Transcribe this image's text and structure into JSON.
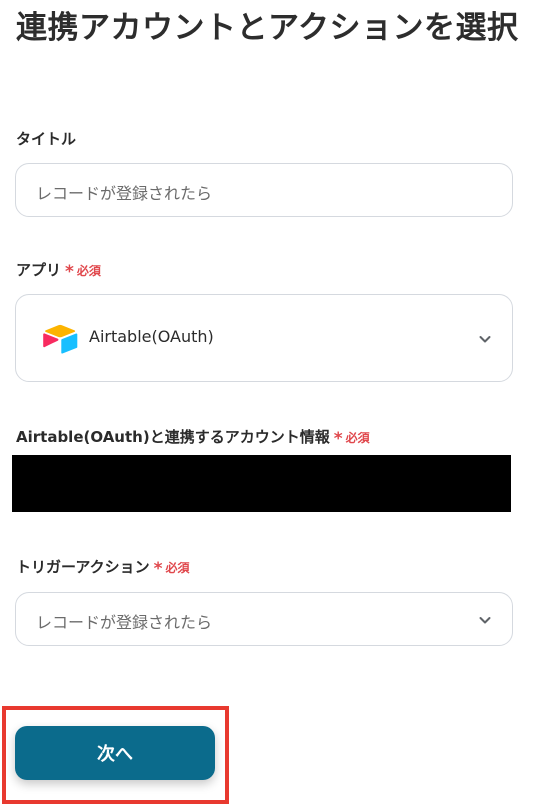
{
  "page": {
    "title": "連携アカウントとアクションを選択"
  },
  "required": {
    "star": "*",
    "text": "必須"
  },
  "fields": {
    "title": {
      "label": "タイトル",
      "value": "レコードが登録されたら"
    },
    "app": {
      "label": "アプリ",
      "value": "Airtable(OAuth)",
      "icon": "airtable-logo-icon"
    },
    "account": {
      "label": "Airtable(OAuth)と連携するアカウント情報"
    },
    "trigger": {
      "label": "トリガーアクション",
      "value": "レコードが登録されたら"
    }
  },
  "buttons": {
    "next_label": "次へ"
  },
  "colors": {
    "primary": "#0b6b8c",
    "required": "#e0474c",
    "highlight": "#e8392f"
  }
}
